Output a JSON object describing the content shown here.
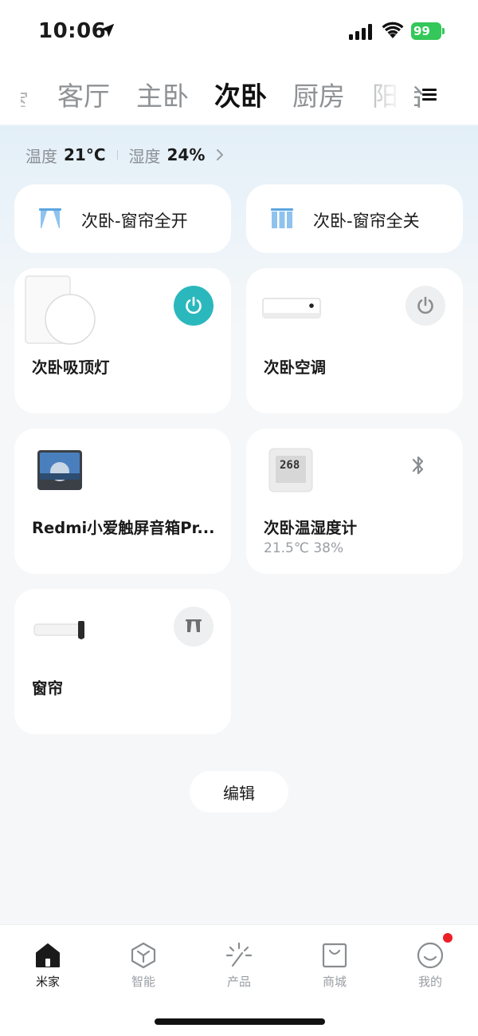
{
  "status_bar": {
    "time": "10:06",
    "battery": "99"
  },
  "tabs": [
    "客厅",
    "主卧",
    "次卧",
    "厨房",
    "阳台"
  ],
  "active_tab": "次卧",
  "env": {
    "temp_label": "温度",
    "temp_value": "21°C",
    "humidity_label": "湿度",
    "humidity_value": "24%"
  },
  "scenes": [
    {
      "label": "次卧-窗帘全开",
      "icon": "curtain-open-icon"
    },
    {
      "label": "次卧-窗帘全关",
      "icon": "curtain-close-icon"
    }
  ],
  "devices": [
    {
      "name": "次卧吸顶灯",
      "sub": "",
      "control": "power",
      "state": "on"
    },
    {
      "name": "次卧空调",
      "sub": "",
      "control": "power",
      "state": "off"
    },
    {
      "name": "Redmi小爱触屏音箱Pr...",
      "sub": ""
    },
    {
      "name": "次卧温湿度计",
      "sub": "21.5℃ 38%",
      "control": "bluetooth",
      "thermo_display": "268"
    },
    {
      "name": "窗帘",
      "sub": "",
      "control": "curtain"
    }
  ],
  "edit_label": "编辑",
  "bottom_nav": [
    {
      "label": "米家",
      "icon": "home-icon",
      "active": true
    },
    {
      "label": "智能",
      "icon": "smart-cube-icon",
      "active": false
    },
    {
      "label": "产品",
      "icon": "product-sparkle-icon",
      "active": false
    },
    {
      "label": "商城",
      "icon": "shopping-bag-icon",
      "active": false
    },
    {
      "label": "我的",
      "icon": "smile-profile-icon",
      "active": false,
      "badge": true
    }
  ],
  "colors": {
    "accent": "#2bb8bd",
    "badge": "#ec1f27",
    "battery": "#34c759"
  }
}
